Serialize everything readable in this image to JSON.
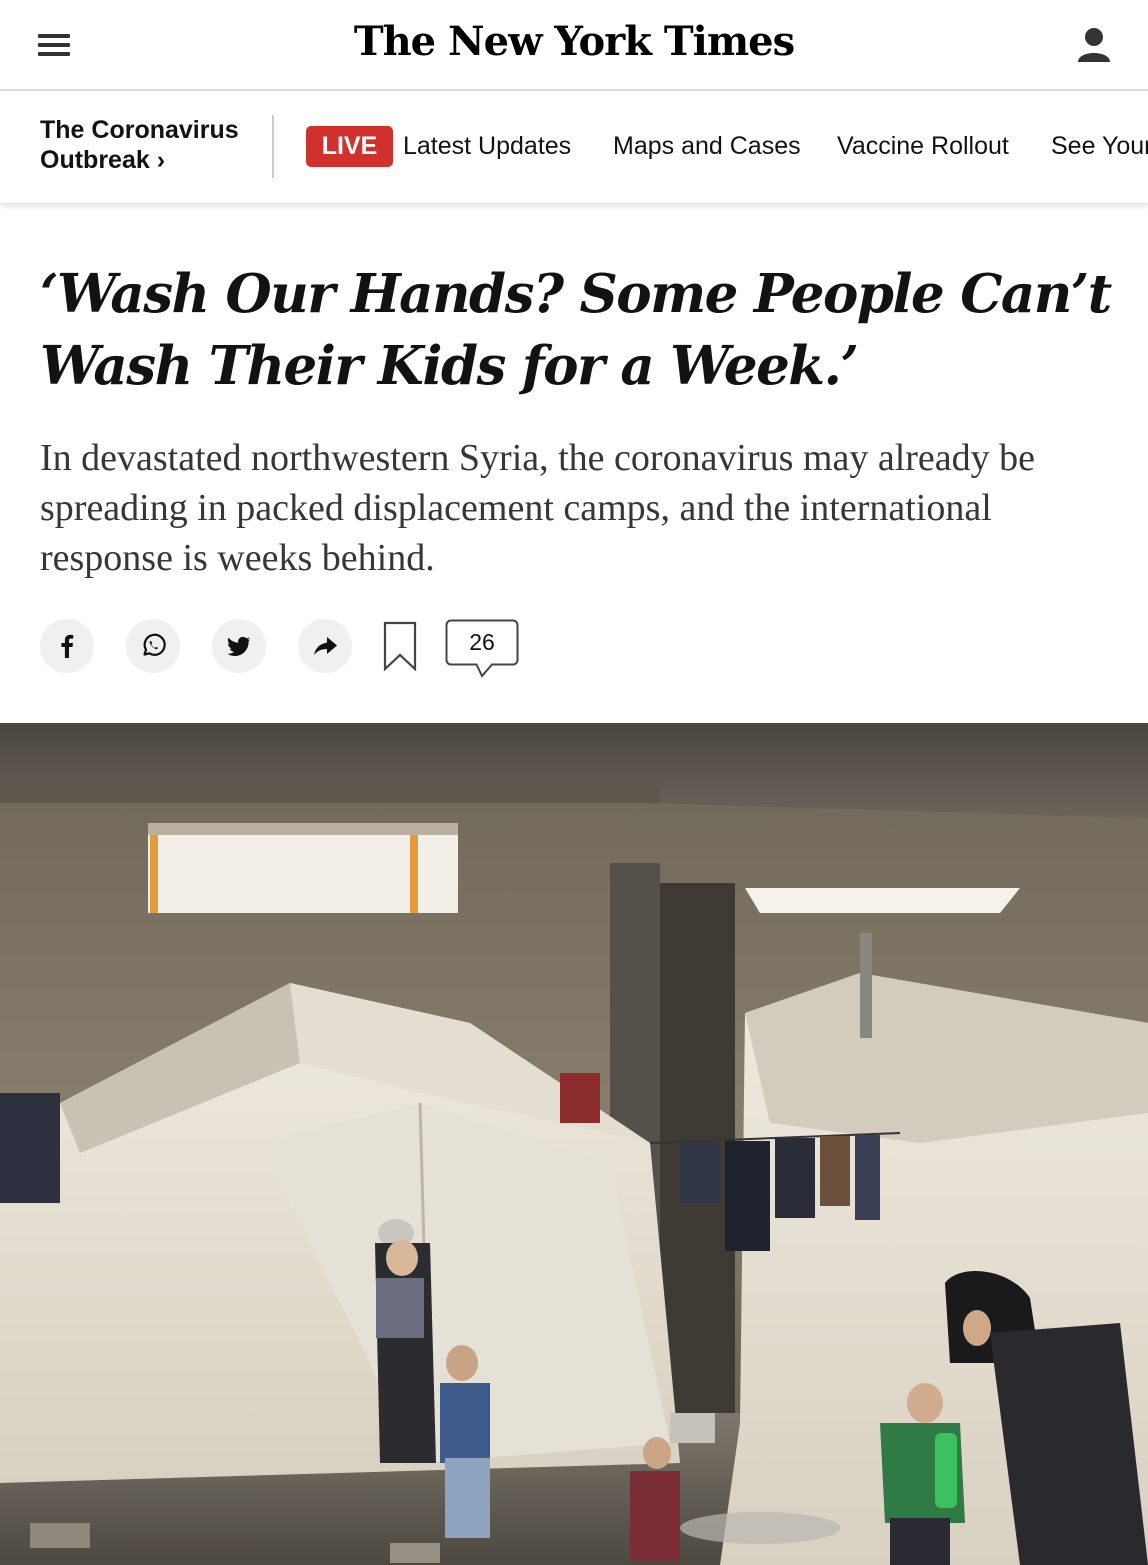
{
  "masthead": {
    "logo": "The New York Times",
    "menu_icon": "hamburger-icon",
    "account_icon": "account-icon"
  },
  "subnav": {
    "section": {
      "line1": "The Coronavirus",
      "line2": "Outbreak ›"
    },
    "live": "LIVE",
    "links": [
      "Latest Updates",
      "Maps and Cases",
      "Vaccine Rollout",
      "See Your"
    ]
  },
  "article": {
    "headline": "‘Wash Our Hands? Some People Can’t Wash Their Kids for a Week.’",
    "summary": "In devastated northwestern Syria, the coronavirus may already be spreading in packed displacement camps, and the international response is weeks behind."
  },
  "share": {
    "icons": [
      "facebook-icon",
      "whatsapp-icon",
      "twitter-icon",
      "share-icon",
      "bookmark-icon",
      "comment-icon"
    ],
    "comment_count": "26"
  },
  "colors": {
    "live_red": "#d0312d",
    "text": "#121212",
    "summary_text": "#363636",
    "share_bg": "#f0f0f0"
  }
}
